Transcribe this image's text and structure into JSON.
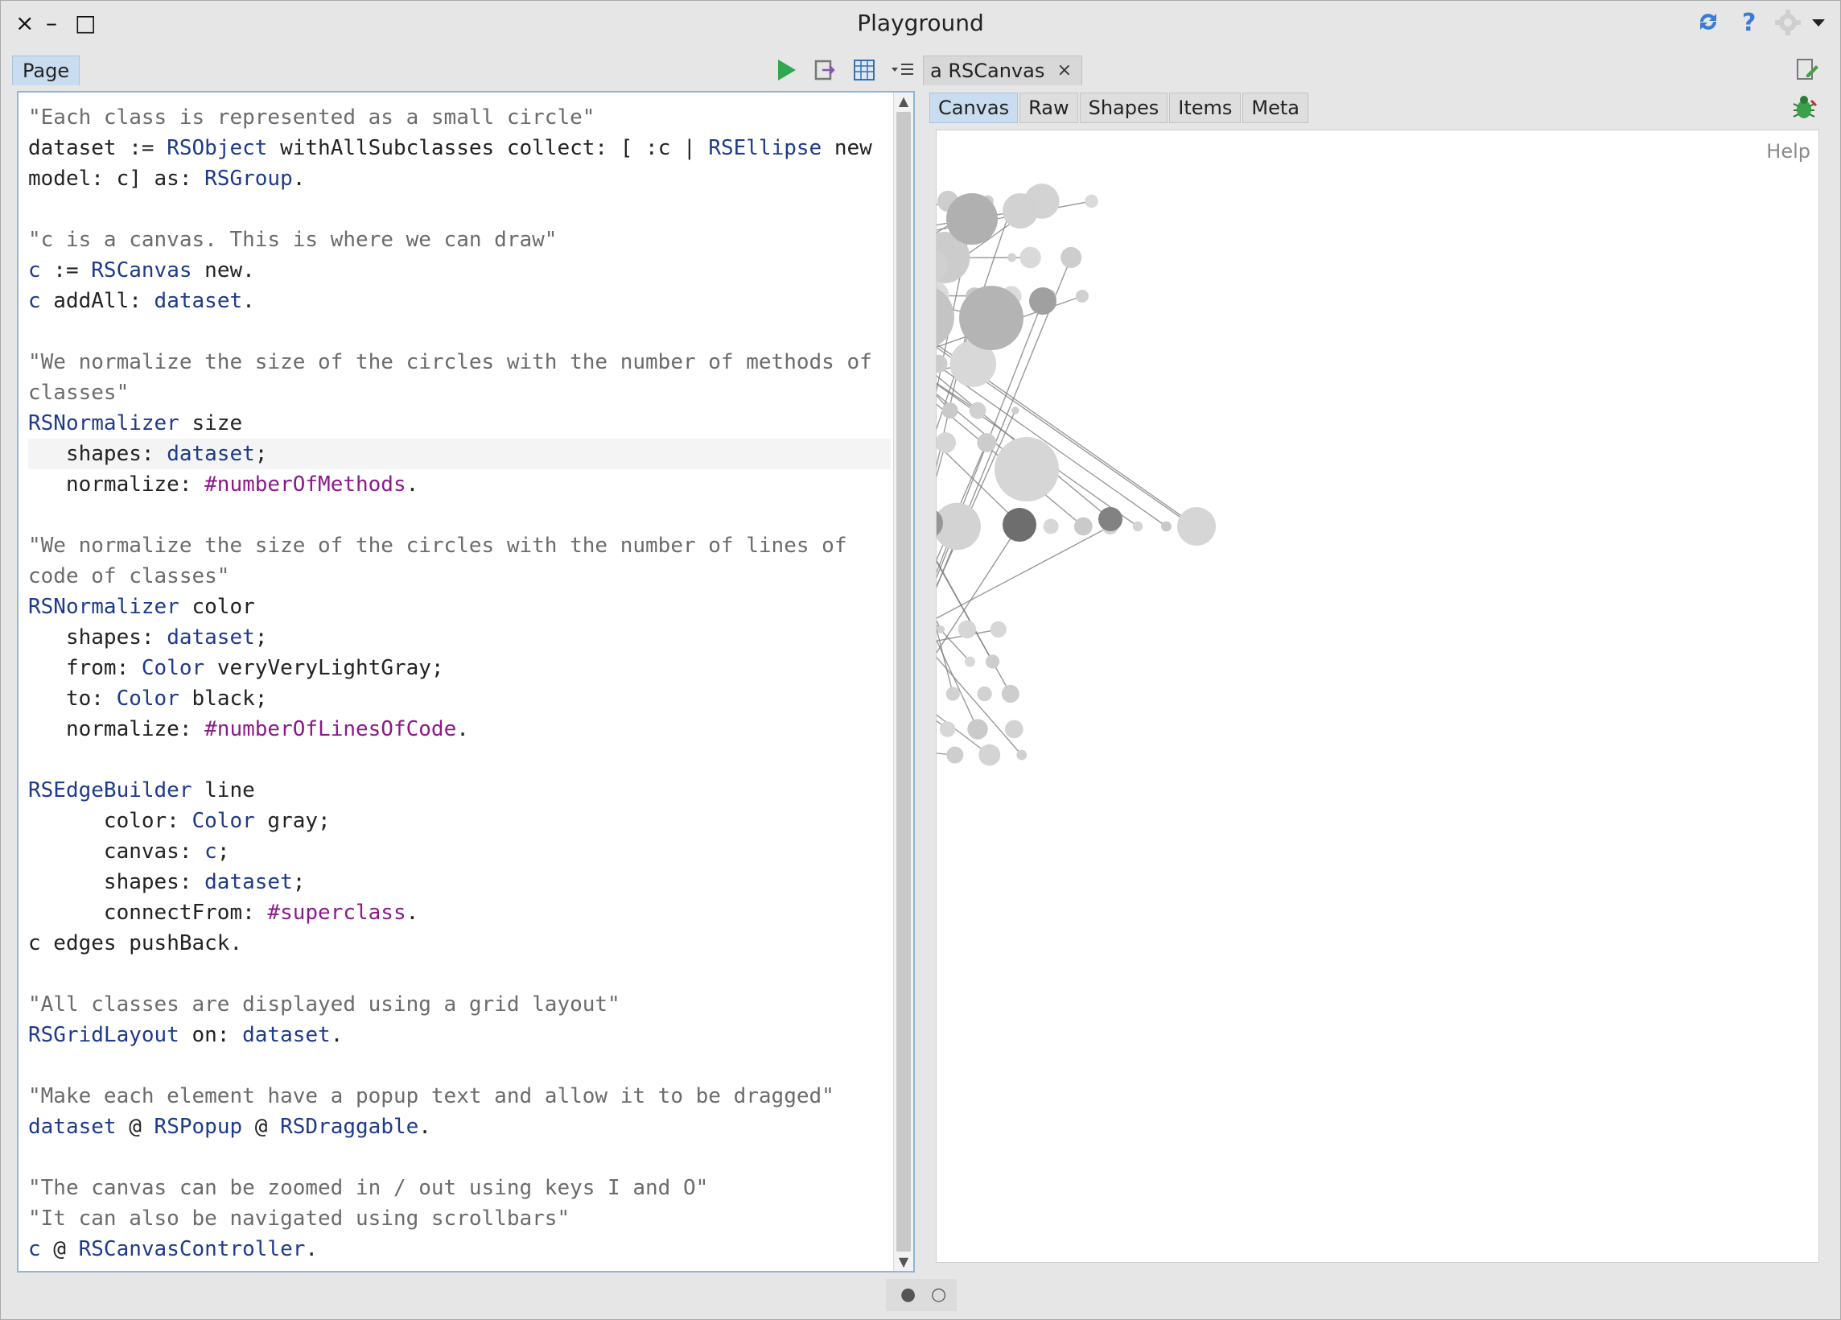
{
  "window": {
    "title": "Playground",
    "close_glyph": "×",
    "minimize_glyph": "–",
    "maximize_glyph": "□",
    "icons": [
      "sync-icon",
      "help-icon",
      "settings-gear-icon",
      "dropdown-arrow-icon"
    ]
  },
  "left_pane": {
    "tab_label": "Page",
    "tool_icons": [
      "run-play-icon",
      "execute-inspect-icon",
      "bindings-table-icon",
      "menu-list-icon"
    ],
    "code_lines": [
      [
        {
          "t": "\"Each class is represented as a small circle\"",
          "k": "com"
        }
      ],
      [
        {
          "t": "dataset",
          "k": ""
        },
        {
          "t": " := ",
          "k": ""
        },
        {
          "t": "RSObject",
          "k": "cls"
        },
        {
          "t": " withAllSubclasses collect: [ :c | ",
          "k": ""
        },
        {
          "t": "RSEllipse",
          "k": "cls"
        },
        {
          "t": " new",
          "k": ""
        }
      ],
      [
        {
          "t": "model: c] as: ",
          "k": ""
        },
        {
          "t": "RSGroup",
          "k": "cls"
        },
        {
          "t": ".",
          "k": ""
        }
      ],
      [],
      [
        {
          "t": "\"c is a canvas. This is where we can draw\"",
          "k": "com"
        }
      ],
      [
        {
          "t": "c",
          "k": "cls"
        },
        {
          "t": " := ",
          "k": ""
        },
        {
          "t": "RSCanvas",
          "k": "cls"
        },
        {
          "t": " new.",
          "k": ""
        }
      ],
      [
        {
          "t": "c",
          "k": "cls"
        },
        {
          "t": " addAll: ",
          "k": ""
        },
        {
          "t": "dataset",
          "k": "cls"
        },
        {
          "t": ".",
          "k": ""
        }
      ],
      [],
      [
        {
          "t": "\"We normalize the size of the circles with the number of methods of",
          "k": "com"
        }
      ],
      [
        {
          "t": "classes\"",
          "k": "com"
        }
      ],
      [
        {
          "t": "RSNormalizer",
          "k": "cls"
        },
        {
          "t": " size",
          "k": ""
        }
      ],
      [
        {
          "t": "   shapes: ",
          "k": ""
        },
        {
          "t": "dataset",
          "k": "cls"
        },
        {
          "t": ";",
          "k": ""
        }
      ],
      [
        {
          "t": "   normalize: ",
          "k": ""
        },
        {
          "t": "#numberOfMethods",
          "k": "sym"
        },
        {
          "t": ".",
          "k": ""
        }
      ],
      [],
      [
        {
          "t": "\"We normalize the size of the circles with the number of lines of",
          "k": "com"
        }
      ],
      [
        {
          "t": "code of classes\"",
          "k": "com"
        }
      ],
      [
        {
          "t": "RSNormalizer",
          "k": "cls"
        },
        {
          "t": " color",
          "k": ""
        }
      ],
      [
        {
          "t": "   shapes: ",
          "k": ""
        },
        {
          "t": "dataset",
          "k": "cls"
        },
        {
          "t": ";",
          "k": ""
        }
      ],
      [
        {
          "t": "   from: ",
          "k": ""
        },
        {
          "t": "Color",
          "k": "cls"
        },
        {
          "t": " veryVeryLightGray;",
          "k": ""
        }
      ],
      [
        {
          "t": "   to: ",
          "k": ""
        },
        {
          "t": "Color",
          "k": "cls"
        },
        {
          "t": " black;",
          "k": ""
        }
      ],
      [
        {
          "t": "   normalize: ",
          "k": ""
        },
        {
          "t": "#numberOfLinesOfCode",
          "k": "sym"
        },
        {
          "t": ".",
          "k": ""
        }
      ],
      [],
      [
        {
          "t": "RSEdgeBuilder",
          "k": "cls"
        },
        {
          "t": " line",
          "k": ""
        }
      ],
      [
        {
          "t": "      color: ",
          "k": ""
        },
        {
          "t": "Color",
          "k": "cls"
        },
        {
          "t": " gray;",
          "k": ""
        }
      ],
      [
        {
          "t": "      canvas: ",
          "k": ""
        },
        {
          "t": "c",
          "k": "cls"
        },
        {
          "t": ";",
          "k": ""
        }
      ],
      [
        {
          "t": "      shapes: ",
          "k": ""
        },
        {
          "t": "dataset",
          "k": "cls"
        },
        {
          "t": ";",
          "k": ""
        }
      ],
      [
        {
          "t": "      connectFrom: ",
          "k": ""
        },
        {
          "t": "#superclass",
          "k": "sym"
        },
        {
          "t": ".",
          "k": ""
        }
      ],
      [
        {
          "t": "c",
          "k": ""
        },
        {
          "t": " edges pushBack.",
          "k": ""
        }
      ],
      [],
      [
        {
          "t": "\"All classes are displayed using a grid layout\"",
          "k": "com"
        }
      ],
      [
        {
          "t": "RSGridLayout",
          "k": "cls"
        },
        {
          "t": " on: ",
          "k": ""
        },
        {
          "t": "dataset",
          "k": "cls"
        },
        {
          "t": ".",
          "k": ""
        }
      ],
      [],
      [
        {
          "t": "\"Make each element have a popup text and allow it to be dragged\"",
          "k": "com"
        }
      ],
      [
        {
          "t": "dataset",
          "k": "cls"
        },
        {
          "t": " @ ",
          "k": ""
        },
        {
          "t": "RSPopup",
          "k": "cls"
        },
        {
          "t": " @ ",
          "k": ""
        },
        {
          "t": "RSDraggable",
          "k": "cls"
        },
        {
          "t": ".",
          "k": ""
        }
      ],
      [],
      [
        {
          "t": "\"The canvas can be zoomed in / out using keys I and O\"",
          "k": "com"
        }
      ],
      [
        {
          "t": "\"It can also be navigated using scrollbars\"",
          "k": "com"
        }
      ],
      [
        {
          "t": "c",
          "k": "cls"
        },
        {
          "t": " @ ",
          "k": ""
        },
        {
          "t": "RSCanvasController",
          "k": "cls"
        },
        {
          "t": ".",
          "k": ""
        }
      ]
    ]
  },
  "right_pane": {
    "tab_label": "a RSCanvas",
    "tab_close": "×",
    "subtabs": [
      "Canvas",
      "Raw",
      "Shapes",
      "Items",
      "Meta"
    ],
    "active_subtab": "Canvas",
    "help_label": "Help"
  },
  "colors": {
    "accent_tab": "#c9dcf0",
    "play_green": "#2fa84f",
    "class_blue": "#1e3a8a",
    "symbol_purple": "#8a1a8a",
    "comment_gray": "#6b6b6b",
    "edge_gray": "#808080"
  },
  "pager": {
    "dots": [
      "●",
      "○"
    ]
  }
}
